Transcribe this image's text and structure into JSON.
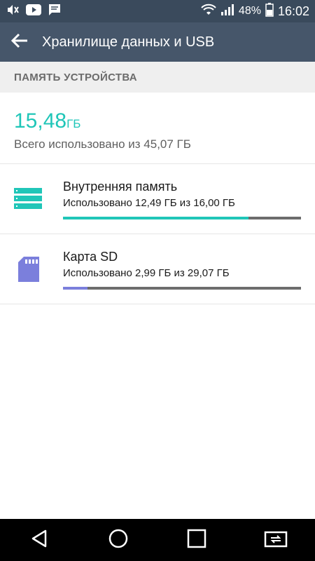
{
  "status_bar": {
    "battery_percent": "48%",
    "time": "16:02",
    "icons": [
      "mute-icon",
      "youtube-icon",
      "message-icon",
      "wifi-icon",
      "signal-icon",
      "battery-icon"
    ]
  },
  "app_bar": {
    "title": "Хранилище данных и USB"
  },
  "section": {
    "header": "ПАМЯТЬ УСТРОЙСТВА"
  },
  "summary": {
    "used_value": "15,48",
    "used_unit": "ГБ",
    "total_text": "Всего использовано из 45,07 ГБ"
  },
  "storage_items": [
    {
      "title": "Внутренняя память",
      "subtitle": "Использовано 12,49 ГБ из 16,00 ГБ",
      "used_fraction": 0.78,
      "bar_color": "#20c6b8",
      "icon": "internal-storage-icon"
    },
    {
      "title": "Карта SD",
      "subtitle": "Использовано 2,99 ГБ из 29,07 ГБ",
      "used_fraction": 0.103,
      "bar_color": "#7b7fdc",
      "icon": "sd-card-icon"
    }
  ],
  "nav_bar": {
    "buttons": [
      "back-icon",
      "home-icon",
      "recents-icon",
      "switch-app-icon"
    ]
  },
  "colors": {
    "status_bar": "#3a4a5c",
    "app_bar": "#46566a",
    "accent": "#20c6b8",
    "sd_card": "#7b7fdc"
  }
}
